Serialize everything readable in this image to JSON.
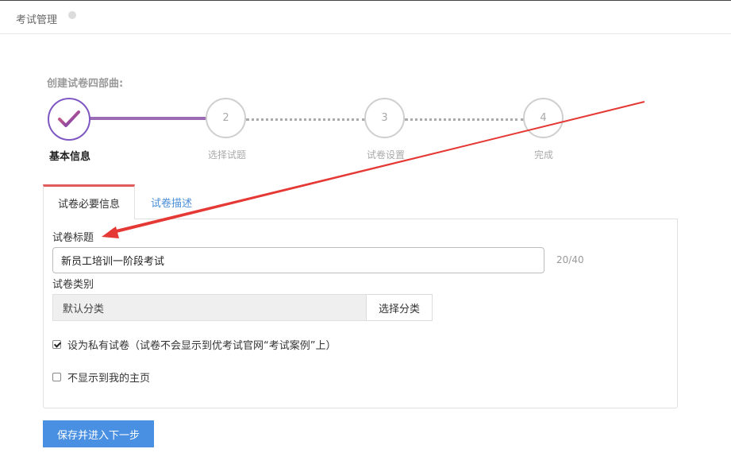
{
  "header": {
    "title": "考试管理"
  },
  "steps": {
    "heading": "创建试卷四部曲:",
    "items": [
      {
        "label": "基本信息",
        "state": "done"
      },
      {
        "number": "2",
        "label": "选择试题",
        "state": "todo"
      },
      {
        "number": "3",
        "label": "试卷设置",
        "state": "todo"
      },
      {
        "number": "4",
        "label": "完成",
        "state": "todo"
      }
    ]
  },
  "tabs": [
    {
      "label": "试卷必要信息",
      "active": true
    },
    {
      "label": "试卷描述",
      "active": false
    }
  ],
  "form": {
    "title_label": "试卷标题",
    "title_value": "新员工培训一阶段考试",
    "title_counter": "20/40",
    "category_label": "试卷类别",
    "category_value": "默认分类",
    "choose_category_label": "选择分类",
    "private_label": "设为私有试卷（试卷不会显示到优考试官网“考试案例”上）",
    "private_checked": true,
    "hide_home_label": "不显示到我的主页",
    "hide_home_checked": false
  },
  "submit_label": "保存并进入下一步",
  "colors": {
    "accent": "#4a90e2",
    "tab_active_border": "#e05b5b",
    "step_done": "#7e57c2",
    "arrow": "#e53935"
  }
}
